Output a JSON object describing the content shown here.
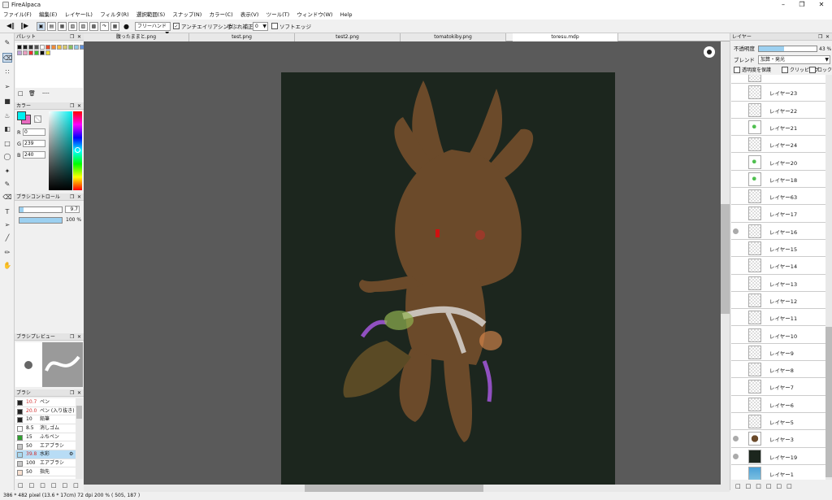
{
  "app": {
    "title": "FireAlpaca"
  },
  "menu": [
    "ファイル(F)",
    "編集(E)",
    "レイヤー(L)",
    "フィルタ(R)",
    "選択範囲(S)",
    "スナップ(N)",
    "カラー(C)",
    "表示(V)",
    "ツール(T)",
    "ウィンドウ(W)",
    "Help"
  ],
  "toolbar": {
    "brush_mode": "フリーハンド",
    "antialias_label": "アンチエイリアシング",
    "stabilizer_label": "手ぶれ補正",
    "stabilizer_value": "0",
    "softedge_label": "ソフトエッジ"
  },
  "tabs": [
    "腹ったままと.png",
    "test.png",
    "test2.png",
    "tomatokiby.png",
    "toresu.mdp"
  ],
  "palette": {
    "title": "パレット",
    "colors": [
      "#111111",
      "#222222",
      "#333333",
      "#555555",
      "#ffffff",
      "#e64a2a",
      "#f08a3a",
      "#f5c040",
      "#d8c870",
      "#8ac060",
      "#90c8e8",
      "#6090d8",
      "#c0a0d8",
      "#e8a0c0",
      "#e83030",
      "#40c030",
      "#111111",
      "#f0e030"
    ],
    "extra": "----"
  },
  "color_panel": {
    "title": "カラー",
    "r_label": "R",
    "r": "0",
    "g_label": "G",
    "g": "239",
    "b_label": "B",
    "b": "240",
    "fg": "#00eff0",
    "bg": "#e86ac0"
  },
  "brush_control": {
    "title": "ブラシコントロール",
    "size": "9.7",
    "opacity": "100 %",
    "opacity_pct": 100,
    "size_fraction": 0.1
  },
  "brush_preview": {
    "title": "ブラシプレビュー"
  },
  "brushes": {
    "title": "ブラシ",
    "items": [
      {
        "size": "10.7",
        "name": "ペン",
        "color": "#222222",
        "size_red": true
      },
      {
        "size": "20.0",
        "name": "ペン (入り抜き)",
        "color": "#222222",
        "size_red": true
      },
      {
        "size": "10",
        "name": "鉛筆",
        "color": "#222222"
      },
      {
        "size": "8.5",
        "name": "消しゴム",
        "color": "#ffffff"
      },
      {
        "size": "15",
        "name": "ふちペン",
        "color": "#30a030"
      },
      {
        "size": "50",
        "name": "エアブラシ",
        "color": "#c8c8c8"
      },
      {
        "size": "39.8",
        "name": "水彩",
        "color": "#a8d8f0",
        "selected": true,
        "size_red": true
      },
      {
        "size": "100",
        "name": "エアブラシ",
        "color": "#c8c8c8"
      },
      {
        "size": "50",
        "name": "指先",
        "color": "#f8e0d0"
      }
    ]
  },
  "layers_panel": {
    "title": "レイヤー",
    "opacity_label": "不透明度",
    "opacity": "43 %",
    "opacity_pct": 43,
    "blend_label": "ブレンド",
    "blend_value": "加算・発光",
    "protect_label": "透明度を保護",
    "clip_label": "クリッピング",
    "lock_label": "ロック",
    "layers": [
      {
        "name": "",
        "dot": false
      },
      {
        "name": "レイヤー23",
        "dot": false
      },
      {
        "name": "レイヤー22",
        "dot": false
      },
      {
        "name": "レイヤー21",
        "dot": false,
        "thumb": "green"
      },
      {
        "name": "レイヤー24",
        "dot": false
      },
      {
        "name": "レイヤー20",
        "dot": false,
        "thumb": "green"
      },
      {
        "name": "レイヤー18",
        "dot": false,
        "thumb": "green"
      },
      {
        "name": "レイヤー63",
        "dot": false
      },
      {
        "name": "レイヤー17",
        "dot": false
      },
      {
        "name": "レイヤー16",
        "dot": true
      },
      {
        "name": "レイヤー15",
        "dot": false
      },
      {
        "name": "レイヤー14",
        "dot": false
      },
      {
        "name": "レイヤー13",
        "dot": false
      },
      {
        "name": "レイヤー12",
        "dot": false
      },
      {
        "name": "レイヤー11",
        "dot": false
      },
      {
        "name": "レイヤー10",
        "dot": false
      },
      {
        "name": "レイヤー9",
        "dot": false
      },
      {
        "name": "レイヤー8",
        "dot": false
      },
      {
        "name": "レイヤー7",
        "dot": false
      },
      {
        "name": "レイヤー6",
        "dot": false
      },
      {
        "name": "レイヤー5",
        "dot": false
      },
      {
        "name": "レイヤー3",
        "dot": true,
        "thumb": "char"
      },
      {
        "name": "レイヤー19",
        "dot": true,
        "thumb": "dark"
      },
      {
        "name": "レイヤー1",
        "dot": false,
        "thumb": "blue"
      }
    ]
  },
  "status": {
    "text": "386 * 482 pixel  (13.6 * 17cm)  72 dpi  200 %  ( 505, 187 )"
  }
}
